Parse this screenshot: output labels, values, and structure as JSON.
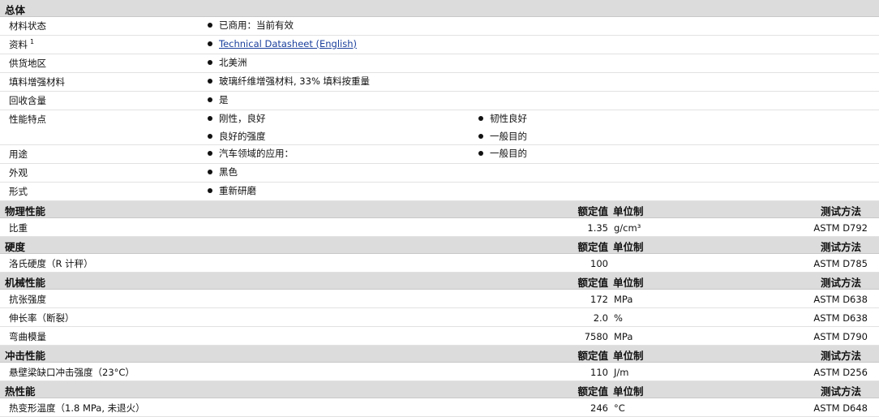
{
  "sections": {
    "overview": {
      "title": "总体"
    },
    "physical": {
      "title": "物理性能",
      "col_value": "额定值",
      "col_unit": "单位制",
      "col_method": "测试方法"
    },
    "hardness": {
      "title": "硬度",
      "col_value": "额定值",
      "col_unit": "单位制",
      "col_method": "测试方法"
    },
    "mechanical": {
      "title": "机械性能",
      "col_value": "额定值",
      "col_unit": "单位制",
      "col_method": "测试方法"
    },
    "impact": {
      "title": "冲击性能",
      "col_value": "额定值",
      "col_unit": "单位制",
      "col_method": "测试方法"
    },
    "thermal": {
      "title": "热性能",
      "col_value": "额定值",
      "col_unit": "单位制",
      "col_method": "测试方法"
    }
  },
  "overview": {
    "status": {
      "label": "材料状态",
      "items": [
        "已商用：当前有效"
      ]
    },
    "docs": {
      "label": "资料",
      "sup": "1",
      "link": "Technical Datasheet (English)"
    },
    "region": {
      "label": "供货地区",
      "items": [
        "北美洲"
      ]
    },
    "filler": {
      "label": "填料增强材料",
      "items": [
        "玻璃纤维增强材料, 33% 填料按重量"
      ]
    },
    "recycled": {
      "label": "回收含量",
      "items": [
        "是"
      ]
    },
    "features": {
      "label": "性能特点",
      "items_a": [
        "刚性，良好",
        "良好的强度"
      ],
      "items_b": [
        "韧性良好",
        "一般目的"
      ]
    },
    "uses": {
      "label": "用途",
      "items_a": [
        "汽车领域的应用："
      ],
      "items_b": [
        "一般目的"
      ]
    },
    "appearance": {
      "label": "外观",
      "items": [
        "黑色"
      ]
    },
    "form": {
      "label": "形式",
      "items": [
        "重新研磨"
      ]
    }
  },
  "props": {
    "gravity": {
      "label": "比重",
      "value": "1.35",
      "unit": "g/cm³",
      "method": "ASTM D792"
    },
    "rockwell": {
      "label": "洛氏硬度（R 计秤）",
      "value": "100",
      "unit": "",
      "method": "ASTM D785"
    },
    "tensile": {
      "label": "抗张强度",
      "value": "172",
      "unit": "MPa",
      "method": "ASTM D638"
    },
    "elong": {
      "label": "伸长率（断裂）",
      "value": "2.0",
      "unit": "%",
      "method": "ASTM D638"
    },
    "flex": {
      "label": "弯曲模量",
      "value": "7580",
      "unit": "MPa",
      "method": "ASTM D790"
    },
    "izod": {
      "label": "悬壁梁缺口冲击强度（23°C）",
      "value": "110",
      "unit": "J/m",
      "method": "ASTM D256"
    },
    "hdt": {
      "label": "热变形温度（1.8 MPa, 未退火）",
      "value": "246",
      "unit": "°C",
      "method": "ASTM D648"
    }
  }
}
